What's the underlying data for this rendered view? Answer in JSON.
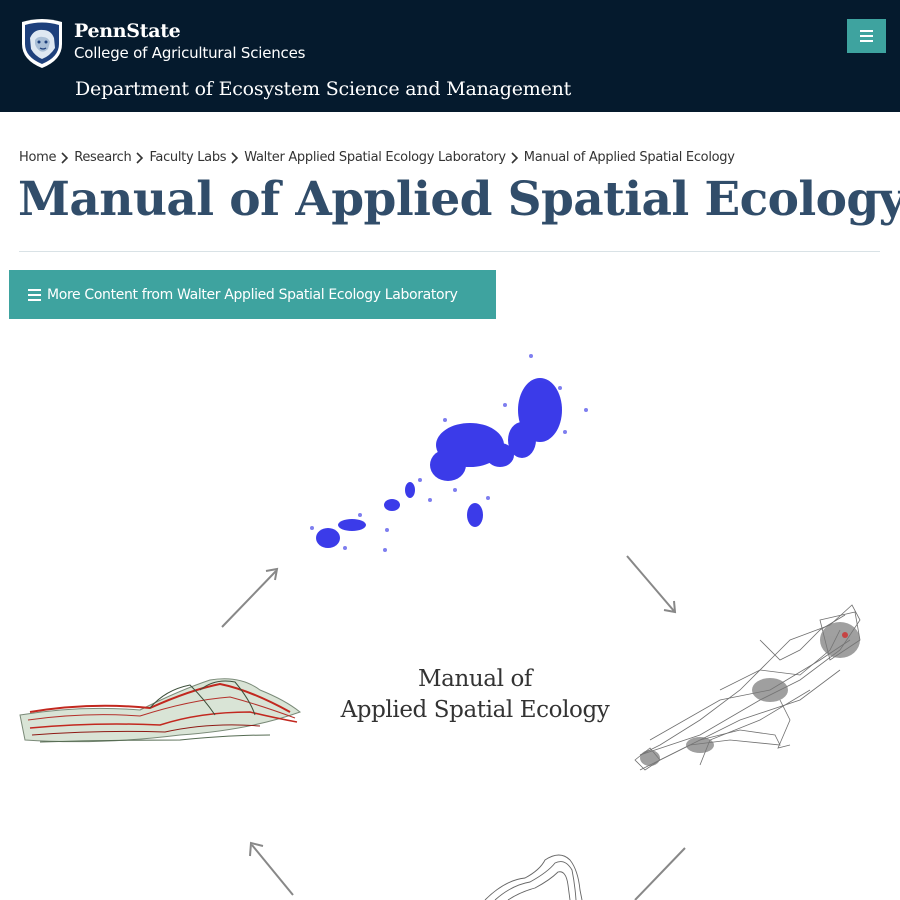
{
  "header": {
    "brand_name": "PennState",
    "college": "College of Agricultural Sciences",
    "department": "Department of Ecosystem Science and Management",
    "menu_icon": "hamburger-icon",
    "accent_color": "#3ea39f",
    "background_color": "#051a2d"
  },
  "breadcrumb": [
    "Home",
    "Research",
    "Faculty Labs",
    "Walter Applied Spatial Ecology Laboratory",
    "Manual of Applied Spatial Ecology"
  ],
  "page": {
    "title": "Manual of Applied Spatial Ecology",
    "title_color": "#314d6a",
    "more_content_label": "More Content from Walter Applied Spatial Ecology Laboratory",
    "more_content_icon": "hamburger-icon"
  },
  "cover": {
    "caption_line1": "Manual of",
    "caption_line2": "Applied Spatial Ecology"
  }
}
